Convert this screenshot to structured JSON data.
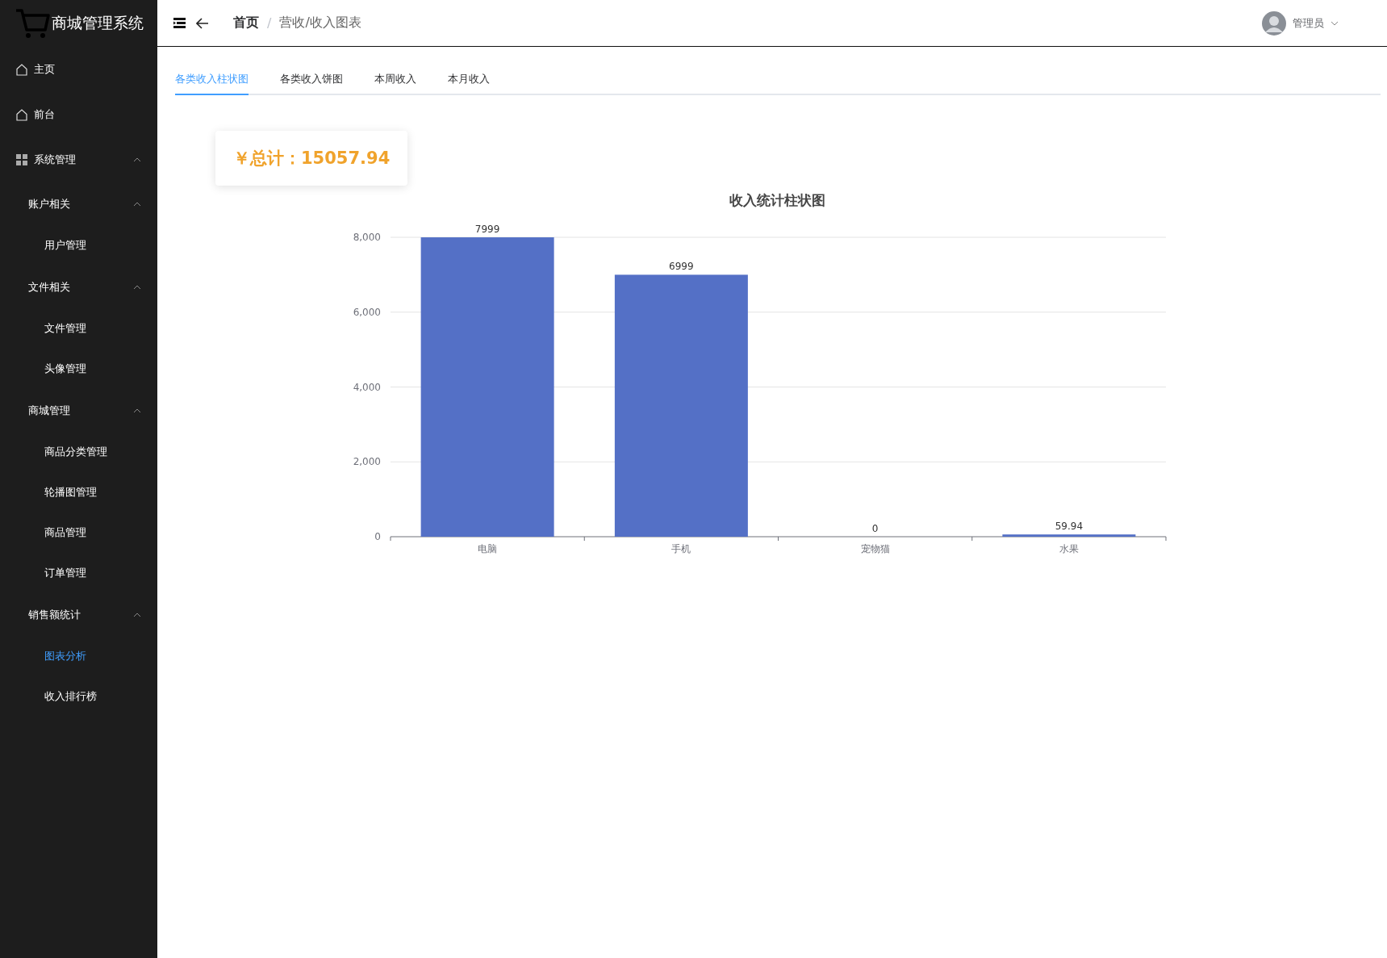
{
  "sidebar": {
    "logo": "商城管理系统",
    "items": [
      {
        "label": "主页",
        "kind": "page",
        "selected": false
      },
      {
        "label": "前台",
        "kind": "page",
        "selected": false
      },
      {
        "label": "系统管理",
        "kind": "group",
        "expanded": true,
        "children": [
          {
            "label": "账户相关",
            "kind": "group",
            "expanded": true,
            "children": [
              {
                "label": "用户管理",
                "kind": "page",
                "selected": false
              }
            ]
          },
          {
            "label": "文件相关",
            "kind": "group",
            "expanded": true,
            "children": [
              {
                "label": "文件管理",
                "kind": "page",
                "selected": false
              },
              {
                "label": "头像管理",
                "kind": "page",
                "selected": false
              }
            ]
          },
          {
            "label": "商城管理",
            "kind": "group",
            "expanded": true,
            "children": [
              {
                "label": "商品分类管理",
                "kind": "page",
                "selected": false
              },
              {
                "label": "轮播图管理",
                "kind": "page",
                "selected": false
              },
              {
                "label": "商品管理",
                "kind": "page",
                "selected": false
              },
              {
                "label": "订单管理",
                "kind": "page",
                "selected": false
              }
            ]
          },
          {
            "label": "销售额统计",
            "kind": "group",
            "expanded": true,
            "children": [
              {
                "label": "图表分析",
                "kind": "page",
                "selected": true
              },
              {
                "label": "收入排行榜",
                "kind": "page",
                "selected": false
              }
            ]
          }
        ]
      }
    ]
  },
  "header": {
    "breadcrumb": [
      "首页",
      "营收/收入图表"
    ],
    "separator": "/",
    "user": "管理员"
  },
  "tabs": [
    {
      "label": "各类收入柱状图",
      "selected": true
    },
    {
      "label": "各类收入饼图",
      "selected": false
    },
    {
      "label": "本周收入",
      "selected": false
    },
    {
      "label": "本月收入",
      "selected": false
    }
  ],
  "total": "￥总计：15057.94",
  "chart_data": {
    "type": "bar",
    "title": "收入统计柱状图",
    "categories": [
      "电脑",
      "手机",
      "宠物猫",
      "水果"
    ],
    "series": [
      {
        "color": "#5470c6",
        "values": [
          7999,
          6999,
          0,
          59.94
        ]
      }
    ],
    "grid": true,
    "ylim": [
      0,
      8000
    ],
    "yticks": [
      {
        "value": 0,
        "label": "0"
      },
      {
        "value": 2000,
        "label": "2,000"
      },
      {
        "value": 4000,
        "label": "4,000"
      },
      {
        "value": 6000,
        "label": "6,000"
      },
      {
        "value": 8000,
        "label": "8,000"
      }
    ],
    "data_labels": true
  }
}
